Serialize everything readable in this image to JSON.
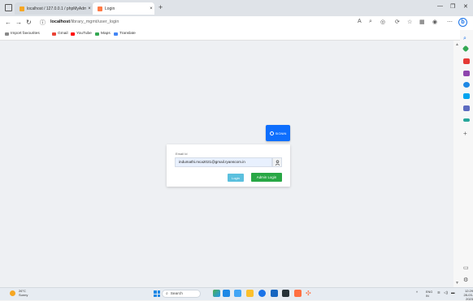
{
  "browser": {
    "tabs": [
      {
        "title": "localhost / 127.0.0.1 / phpMyAdmin",
        "favicon_color": "#f5a623"
      },
      {
        "title": "Login",
        "favicon_color": "#ff7a45"
      }
    ],
    "url_host": "localhost",
    "url_path": "/library_mgmt/user_login",
    "profile_initial": "b",
    "accent_color": "#1a73e8"
  },
  "bookmarks": [
    {
      "label": "Import favourites",
      "color": "#888888"
    },
    {
      "label": "Gmail",
      "color": "#ea4335"
    },
    {
      "label": "YouTube",
      "color": "#ff0000"
    },
    {
      "label": "Maps",
      "color": "#34a853"
    },
    {
      "label": "Translate",
      "color": "#4285f4"
    }
  ],
  "page": {
    "signin_label": "SIGNIN",
    "email_label": "Email Id",
    "email_value": "indumathi.mca2021@gmail.ryanscom.in",
    "login_label": "Login",
    "admin_login_label": "Admin Login",
    "colors": {
      "primary": "#0d6efd",
      "info": "#5bc0de",
      "success": "#28a745"
    }
  },
  "taskbar": {
    "weather_temp": "26°C",
    "weather_desc": "Sunny",
    "search_placeholder": "Search",
    "lang": "ENG",
    "lang_region": "IN",
    "time": "12:29",
    "date": "28-03-2023"
  }
}
